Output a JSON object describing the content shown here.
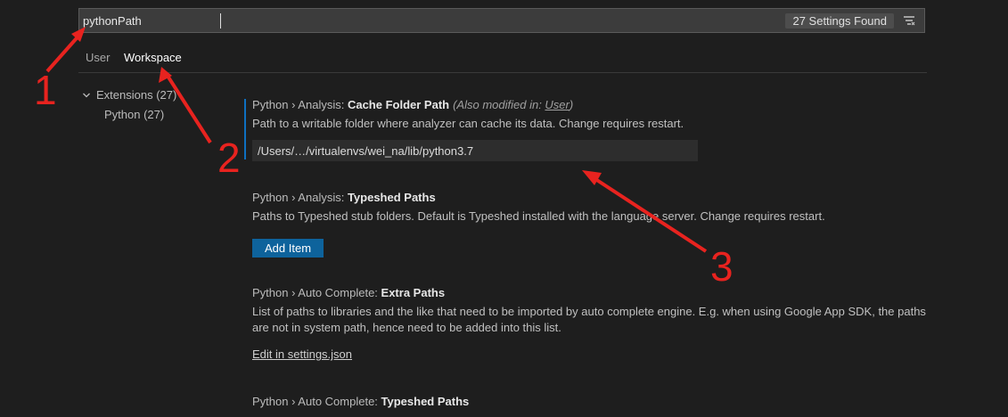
{
  "search": {
    "value": "pythonPath",
    "count_label": "27 Settings Found",
    "filter_icon": "clear-filter-icon"
  },
  "tabs": [
    {
      "label": "User"
    },
    {
      "label": "Workspace"
    }
  ],
  "toc": {
    "extensions_label": "Extensions (27)",
    "python_label": "Python (27)"
  },
  "settings": [
    {
      "category": "Python › Analysis: ",
      "name": "Cache Folder Path",
      "modified": "(Also modified in: ",
      "modified_link": "User",
      "modified_end": ")",
      "description": "Path to a writable folder where analyzer can cache its data. Change requires restart.",
      "value": "/Users/…/virtualenvs/wei_na/lib/python3.7"
    },
    {
      "category": "Python › Analysis: ",
      "name": "Typeshed Paths",
      "description": "Paths to Typeshed stub folders. Default is Typeshed installed with the language server. Change requires restart.",
      "button_label": "Add Item"
    },
    {
      "category": "Python › Auto Complete: ",
      "name": "Extra Paths",
      "description_line1": "List of paths to libraries and the like that need to be imported by auto complete engine. E.g. when using Google App SDK, the paths",
      "description_line2": "are not in system path, hence need to be added into this list.",
      "link_label": "Edit in settings.json"
    },
    {
      "category": "Python › Auto Complete: ",
      "name": "Typeshed Paths"
    }
  ],
  "annotations": [
    {
      "label": "1"
    },
    {
      "label": "2"
    },
    {
      "label": "3"
    }
  ],
  "colors": {
    "background": "#1e1e1e",
    "accent": "#0e639c",
    "focus": "#0e70c0",
    "annotation": "#e8231f"
  }
}
